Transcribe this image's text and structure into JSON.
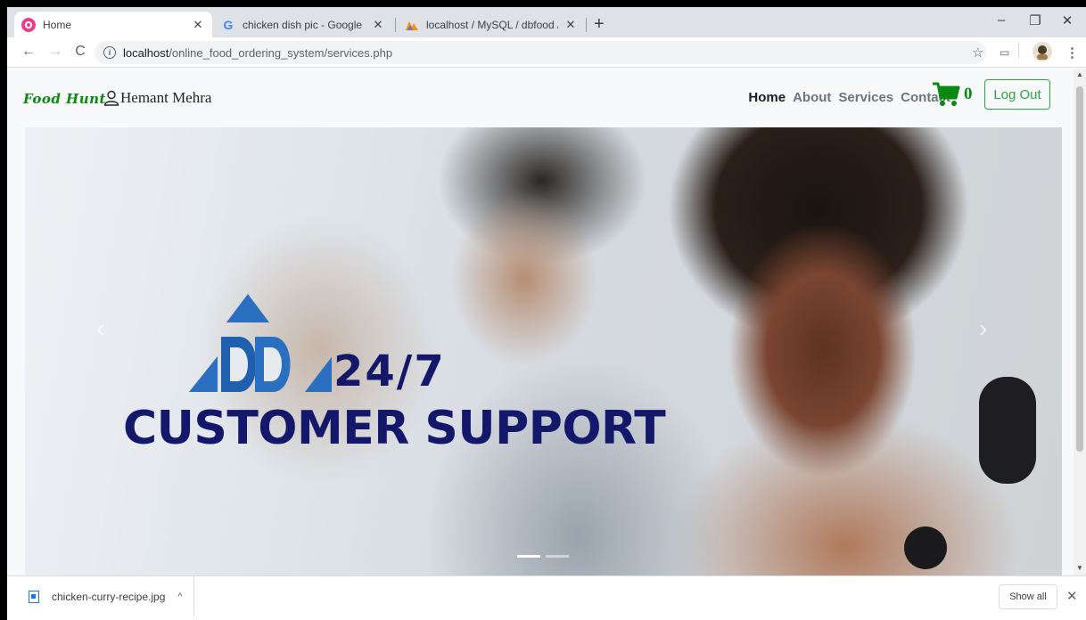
{
  "browser": {
    "tabs": [
      {
        "title": "Home",
        "active": true,
        "favicon": "food-app-icon"
      },
      {
        "title": "chicken dish pic - Google Search",
        "active": false,
        "favicon": "google-icon"
      },
      {
        "title": "localhost / MySQL / dbfood / tba",
        "active": false,
        "favicon": "phpmyadmin-icon"
      }
    ],
    "url_host": "localhost",
    "url_path": "/online_food_ordering_system/services.php"
  },
  "navbar": {
    "brand": "Food Hunt",
    "username": "Hemant Mehra",
    "links": [
      "Home",
      "About",
      "Services",
      "Contact"
    ],
    "active_link": "Home",
    "cart_count": "0",
    "logout_label": "Log Out"
  },
  "carousel": {
    "caption_line1": "24/7",
    "caption_line2": "CUSTOMER SUPPORT",
    "active_slide": 1,
    "slide_count": 2
  },
  "downloads": {
    "filename": "chicken-curry-recipe.jpg",
    "show_all_label": "Show all"
  },
  "colors": {
    "brand_green": "#0b8a10",
    "button_green": "#28a745",
    "caption_navy": "#14186b",
    "logo_blue": "#2a6fc0"
  }
}
